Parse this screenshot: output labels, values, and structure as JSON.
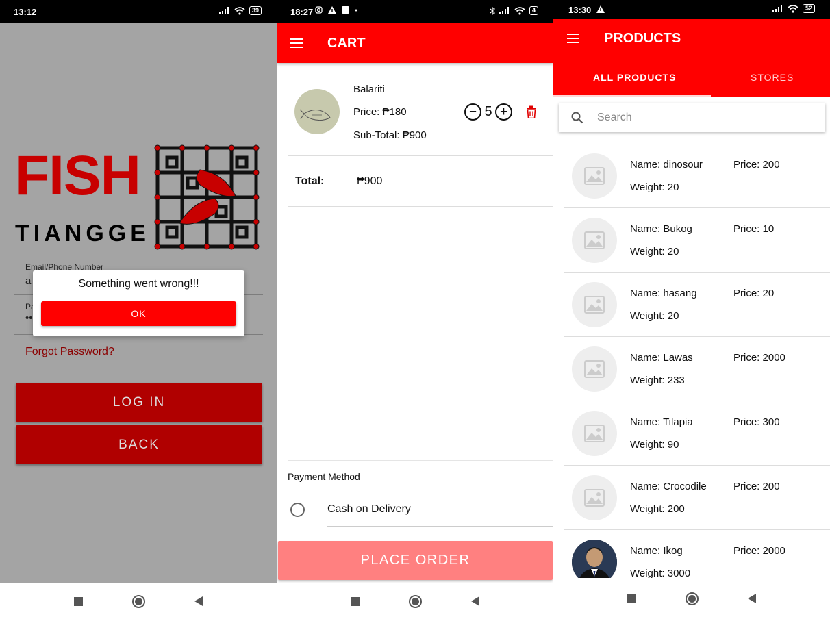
{
  "screens": {
    "login": {
      "status_time": "13:12",
      "battery": "39",
      "logo_line1": "FISH",
      "logo_line2": "TIANGGE",
      "email_label": "Email/Phone Number",
      "email_value": "a",
      "password_label": "Pa",
      "password_value": "••",
      "forgot_password": "Forgot Password?",
      "login_button": "LOG IN",
      "back_button": "BACK",
      "dialog": {
        "message": "Something went wrong!!!",
        "ok_label": "OK"
      }
    },
    "cart": {
      "status_time": "18:27",
      "battery": "4",
      "title": "CART",
      "item": {
        "name": "Balariti",
        "price": "Price: ₱180",
        "subtotal": "Sub-Total: ₱900",
        "quantity": "5",
        "minus_symbol": "−",
        "plus_symbol": "+"
      },
      "total_label": "Total:",
      "total_value": "₱900",
      "payment_label": "Payment Method",
      "payment_option": "Cash on Delivery",
      "place_order": "PLACE ORDER"
    },
    "products": {
      "status_time": "13:30",
      "battery": "52",
      "title": "PRODUCTS",
      "tabs": [
        "ALL PRODUCTS",
        "STORES"
      ],
      "search_placeholder": "Search",
      "items": [
        {
          "name": "Name: dinosour",
          "price": "Price: 200",
          "weight": "Weight: 20",
          "image": "placeholder-image-icon"
        },
        {
          "name": "Name: Bukog",
          "price": "Price: 10",
          "weight": "Weight: 20",
          "image": "placeholder-image-icon"
        },
        {
          "name": "Name: hasang",
          "price": "Price: 20",
          "weight": "Weight: 20",
          "image": "placeholder-image-icon"
        },
        {
          "name": "Name: Lawas",
          "price": "Price: 2000",
          "weight": "Weight: 233",
          "image": "placeholder-image-icon"
        },
        {
          "name": "Name: Tilapia",
          "price": "Price: 300",
          "weight": "Weight: 90",
          "image": "placeholder-image-icon"
        },
        {
          "name": "Name: Crocodile",
          "price": "Price: 200",
          "weight": "Weight: 200",
          "image": "placeholder-image-icon"
        },
        {
          "name": "Name: Ikog",
          "price": "Price: 2000",
          "weight": "Weight: 3000",
          "image": "person-photo"
        }
      ]
    }
  },
  "colors": {
    "primary_red": "#ff0000",
    "dark_red": "#b00000",
    "place_order_disabled": "#ff8080",
    "overlay_gray": "#a4a4a4"
  }
}
